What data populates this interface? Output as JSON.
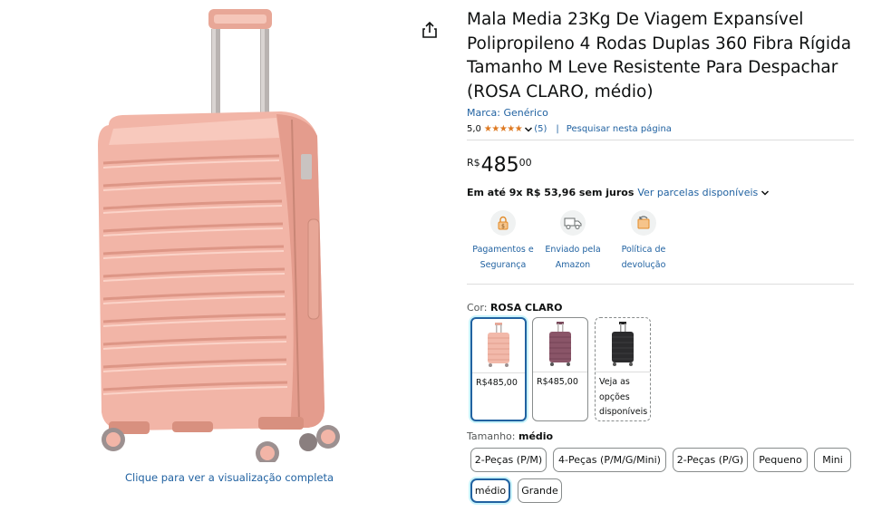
{
  "product": {
    "title": "Mala Media 23Kg De Viagem Expansível Polipropileno 4 Rodas Duplas 360 Fibra Rígida Tamanho M Leve Resistente Para Despachar (ROSA CLARO, médio)",
    "brand": "Marca: Genérico",
    "rating": "5,0",
    "stars": "★★★★★",
    "review_count": "(5)",
    "search_link": "Pesquisar nesta página",
    "image_link": "Clique para ver a visualização completa",
    "share_icon": "share-icon",
    "main_color": "#f0b4a6"
  },
  "price": {
    "currency": "R$",
    "whole": "485",
    "fraction": "00"
  },
  "installments": {
    "text": "Em até 9x R$ 53,96 sem juros",
    "link": "Ver parcelas disponíveis"
  },
  "features": [
    {
      "icon": "secure-payment-icon",
      "line1": "Pagamentos e",
      "line2": "Segurança"
    },
    {
      "icon": "delivery-truck-icon",
      "line1": "Enviado pela",
      "line2": "Amazon"
    },
    {
      "icon": "return-box-icon",
      "line1": "Política de",
      "line2": "devolução"
    }
  ],
  "color": {
    "label": "Cor:",
    "selected": "ROSA CLARO",
    "options": [
      {
        "swatch_color": "#f2b9aa",
        "price": "R$485,00"
      },
      {
        "swatch_color": "#8a5568",
        "price": "R$485,00"
      },
      {
        "swatch_color": "#2b2b2d",
        "line1": "Veja as",
        "line2": "opções",
        "line3": "disponíveis"
      }
    ]
  },
  "size": {
    "label": "Tamanho:",
    "selected": "médio",
    "options": [
      "2-Peças (P/M)",
      "4-Peças (P/M/G/Mini)",
      "2-Peças (P/G)",
      "Pequeno",
      "Mini",
      "médio",
      "Grande"
    ]
  },
  "colors": {
    "link": "#2162a1",
    "star": "#de7921",
    "selected_border": "#2162a1"
  }
}
